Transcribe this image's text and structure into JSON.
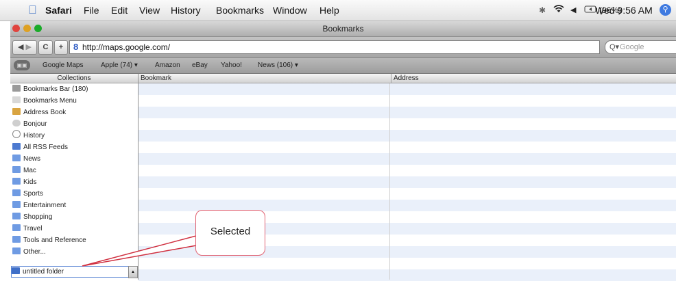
{
  "menubar": {
    "apple_icon": "apple-icon",
    "items": [
      "Safari",
      "File",
      "Edit",
      "View",
      "History",
      "Bookmarks",
      "Window",
      "Help"
    ],
    "status": {
      "bluetooth_icon": "bluetooth-icon",
      "wifi_icon": "wifi-icon",
      "volume_icon": "volume-icon",
      "battery_icon": "battery-icon",
      "battery_text": "(96%)",
      "clock": "Wed 9:56 AM",
      "spotlight_icon": "spotlight-icon"
    }
  },
  "window": {
    "title": "Bookmarks",
    "traffic_lights": {
      "close": "#e0443e",
      "minimize": "#dea123",
      "zoom": "#1aab29"
    }
  },
  "toolbar": {
    "back_icon": "back-arrow-icon",
    "forward_icon": "forward-arrow-icon",
    "reload_icon": "reload-icon",
    "add_bookmark_icon": "plus-icon",
    "url": "http://maps.google.com/",
    "search_placeholder": "Google"
  },
  "bookmarks_bar": {
    "show_all_icon": "open-book-icon",
    "items": [
      "Google Maps",
      "Apple (74) ▾",
      "Amazon",
      "eBay",
      "Yahoo!",
      "News (106) ▾"
    ]
  },
  "sidebar": {
    "header": "Collections",
    "items": [
      {
        "label": "Bookmarks Bar (180)",
        "icon": "bookmarks-bar-icon"
      },
      {
        "label": "Bookmarks Menu",
        "icon": "bookmarks-menu-icon"
      },
      {
        "label": "Address Book",
        "icon": "address-book-icon"
      },
      {
        "label": "Bonjour",
        "icon": "bonjour-icon"
      },
      {
        "label": "History",
        "icon": "clock-icon"
      },
      {
        "label": "All RSS Feeds",
        "icon": "rss-icon"
      },
      {
        "label": "News",
        "icon": "folder-icon"
      },
      {
        "label": "Mac",
        "icon": "folder-icon"
      },
      {
        "label": "Kids",
        "icon": "folder-icon"
      },
      {
        "label": "Sports",
        "icon": "folder-icon"
      },
      {
        "label": "Entertainment",
        "icon": "folder-icon"
      },
      {
        "label": "Shopping",
        "icon": "folder-icon"
      },
      {
        "label": "Travel",
        "icon": "folder-icon"
      },
      {
        "label": "Tools and Reference",
        "icon": "folder-icon"
      },
      {
        "label": "Other...",
        "icon": "folder-icon"
      },
      {
        "label": "untitled folder",
        "icon": "folder-icon"
      }
    ],
    "selected_index": 15
  },
  "table": {
    "columns": [
      "Bookmark",
      "Address"
    ]
  },
  "callout": {
    "text": "Selected"
  },
  "colors": {
    "selection_border": "#5b86d4",
    "row_stripe": "#eaf0fa",
    "callout_border": "#e06070"
  }
}
